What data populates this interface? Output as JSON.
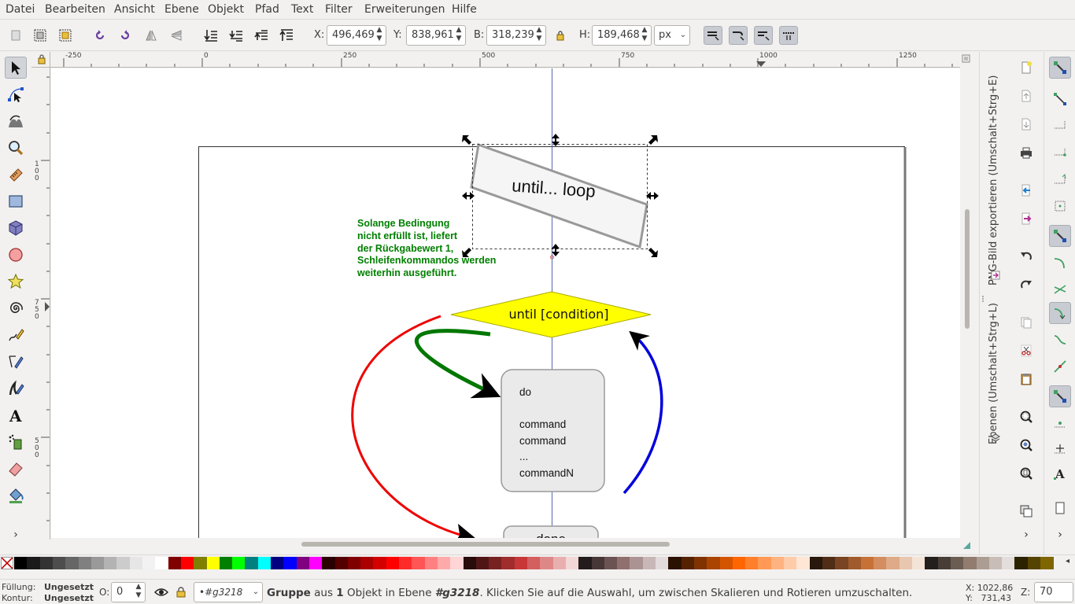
{
  "menu": [
    "Datei",
    "Bearbeiten",
    "Ansicht",
    "Ebene",
    "Objekt",
    "Pfad",
    "Text",
    "Filter",
    "Erweiterungen",
    "Hilfe"
  ],
  "toolbar": {
    "x_label": "X:",
    "x_value": "496,469",
    "y_label": "Y:",
    "y_value": "838,961",
    "w_label": "B:",
    "w_value": "318,239",
    "h_label": "H:",
    "h_value": "189,468",
    "unit": "px"
  },
  "ruler": {
    "top_ticks": [
      "-250",
      "0",
      "250",
      "500",
      "750",
      "1000",
      "1250"
    ],
    "left_ticks": [
      "1\n0\n0",
      "7\n5\n0",
      "5\n0\n0"
    ]
  },
  "drawing": {
    "loop_label": "until... loop",
    "condition_label": "until [condition]",
    "note_lines": [
      "Solange Bedingung",
      "nicht erfüllt ist, liefert",
      "der Rückgabewert 1,",
      "Schleifenkommandos werden",
      "weiterhin ausgeführt."
    ],
    "body_lines": [
      "do",
      "",
      "command",
      "command",
      "...",
      "commandN"
    ],
    "done_label": "done",
    "colors": {
      "condition_fill": "#ffff00",
      "note_text": "#008000",
      "arrow_red": "#ee0000",
      "arrow_green": "#007700",
      "arrow_blue": "#0000dd"
    }
  },
  "dock": {
    "tab_layers": "Ebenen (Umschalt+Strg+L)",
    "tab_export": "PNG-Bild exportieren (Umschalt+Strg+E)"
  },
  "status": {
    "fill_label": "Füllung:",
    "fill_value": "Ungesetzt",
    "stroke_label": "Kontur:",
    "stroke_value": "Ungesetzt",
    "opacity_label": "O:",
    "opacity_value": "0",
    "layer": "•#g3218",
    "msg_bold1": "Gruppe",
    "msg_p1": " aus ",
    "msg_bold2": "1",
    "msg_p2": " Objekt in Ebene ",
    "msg_bold3": "#g3218",
    "msg_p3": ". Klicken Sie auf die Auswahl, um zwischen Skalieren und Rotieren umzuschalten.",
    "cursor_x": "X: 1022,86",
    "cursor_y": "Y:   731,43",
    "zoom_label": "Z:",
    "zoom_value": "70"
  },
  "palette_colors": [
    "#000000",
    "#1a1a1a",
    "#333333",
    "#4d4d4d",
    "#666666",
    "#808080",
    "#999999",
    "#b3b3b3",
    "#cccccc",
    "#e6e6e6",
    "#f2f2f2",
    "#ffffff",
    "#800000",
    "#ff0000",
    "#808000",
    "#ffff00",
    "#008000",
    "#00ff00",
    "#008080",
    "#00ffff",
    "#000080",
    "#0000ff",
    "#800080",
    "#ff00ff",
    "#2b0000",
    "#550000",
    "#800000",
    "#aa0000",
    "#d40000",
    "#ff0000",
    "#ff2a2a",
    "#ff5555",
    "#ff8080",
    "#ffaaaa",
    "#ffd5d5",
    "#280b0b",
    "#501616",
    "#782121",
    "#a02c2c",
    "#c83737",
    "#d35f5f",
    "#de8787",
    "#e9afaf",
    "#f4d7d7",
    "#241c1c",
    "#483737",
    "#6c5353",
    "#916f6f",
    "#ac9393",
    "#c8b7b7",
    "#e3dbdb",
    "#2b1100",
    "#552200",
    "#803300",
    "#aa4400",
    "#d45500",
    "#ff6600",
    "#ff7f2a",
    "#ff9955",
    "#ffb380",
    "#ffccaa",
    "#ffe6d5",
    "#28170b",
    "#502d16",
    "#784421",
    "#a05a2c",
    "#c87137",
    "#d38d5f",
    "#deaa87",
    "#e9c6af",
    "#f4e3d7",
    "#241f1c",
    "#483e37",
    "#6c5d53",
    "#917c6f",
    "#ac9d93",
    "#c8beb7",
    "#e3dedb",
    "#2b2200",
    "#554400",
    "#806600"
  ]
}
